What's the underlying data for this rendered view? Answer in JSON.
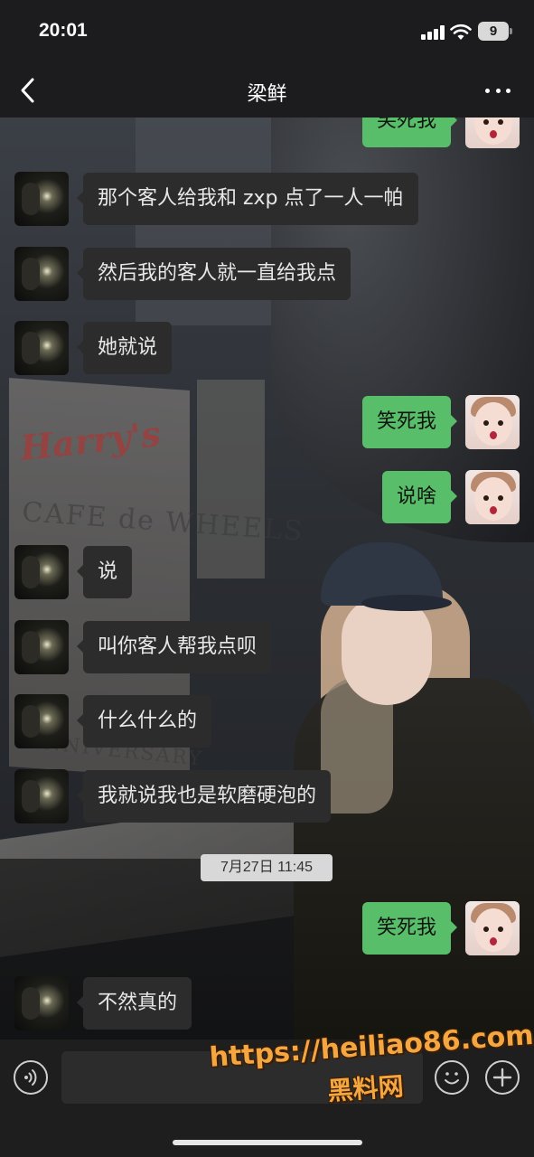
{
  "status_bar": {
    "time": "20:01",
    "battery_level": "9",
    "icons": [
      "signal-icon",
      "wifi-icon",
      "battery-icon"
    ]
  },
  "nav": {
    "title": "梁鲜",
    "back_icon": "chevron-left-icon",
    "more_icon": "more-dots-icon"
  },
  "colors": {
    "my_bubble": "#58be6a",
    "their_bubble": "#2c2c2c",
    "watermark": "#f4a640"
  },
  "messages": [
    {
      "side": "right",
      "text": "笑死我"
    },
    {
      "side": "left",
      "text": "那个客人给我和 zxp 点了一人一帕"
    },
    {
      "side": "left",
      "text": "然后我的客人就一直给我点"
    },
    {
      "side": "left",
      "text": "她就说"
    },
    {
      "side": "right",
      "text": "笑死我"
    },
    {
      "side": "right",
      "text": "说啥"
    },
    {
      "side": "left",
      "text": "说"
    },
    {
      "side": "left",
      "text": "叫你客人帮我点呗"
    },
    {
      "side": "left",
      "text": "什么什么的"
    },
    {
      "side": "left",
      "text": "我就说我也是软磨硬泡的"
    },
    {
      "side": "right",
      "text": "笑死我"
    },
    {
      "side": "left",
      "text": "不然真的"
    }
  ],
  "timestamp": "7月27日 11:45",
  "input_bar": {
    "voice_icon": "voice-icon",
    "input_value": "",
    "emoji_icon": "emoji-icon",
    "add_icon": "plus-icon"
  },
  "watermark": {
    "url": "https://heiliao86.com",
    "name": "黑料网"
  }
}
